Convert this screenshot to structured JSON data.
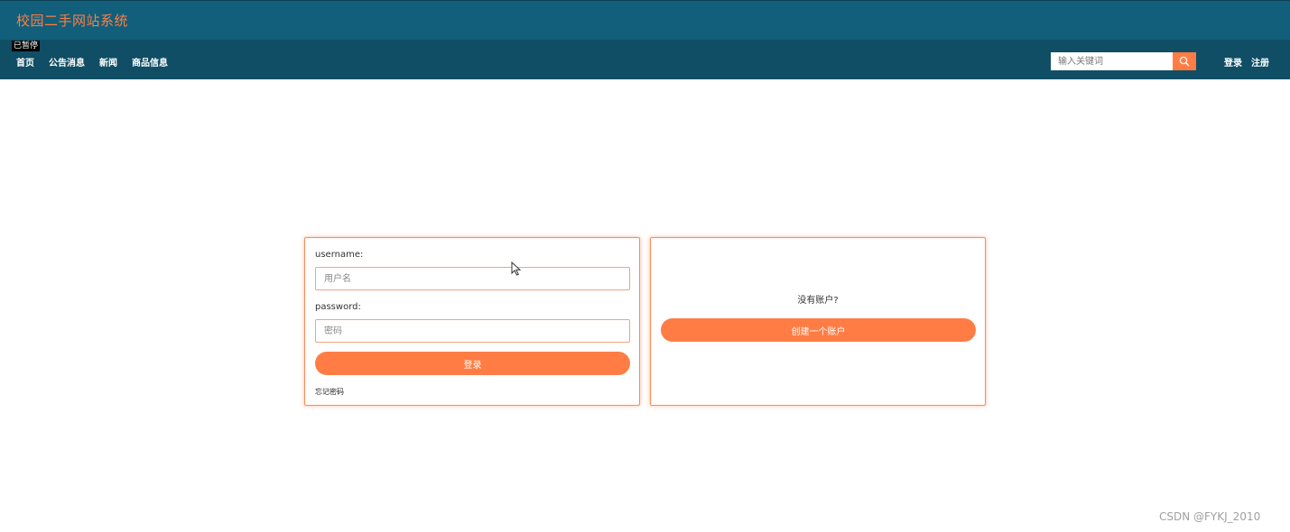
{
  "header": {
    "site_title": "校园二手网站系统"
  },
  "navbar": {
    "paused_label": "已暂停",
    "links": [
      "首页",
      "公告消息",
      "新闻",
      "商品信息"
    ],
    "search": {
      "placeholder": "输入关键词",
      "icon": "search-icon"
    },
    "auth": {
      "login": "登录",
      "register": "注册"
    }
  },
  "login_form": {
    "username_label": "username:",
    "username_placeholder": "用户名",
    "password_label": "password:",
    "password_placeholder": "密码",
    "submit_label": "登录",
    "forgot_label": "忘记密码"
  },
  "register_panel": {
    "prompt": "没有账户?",
    "create_label": "创建一个账户"
  },
  "watermark": "CSDN @FYKJ_2010",
  "colors": {
    "header_bg": "#115f7a",
    "nav_bg": "#0f4e64",
    "accent": "#ff7d44"
  }
}
